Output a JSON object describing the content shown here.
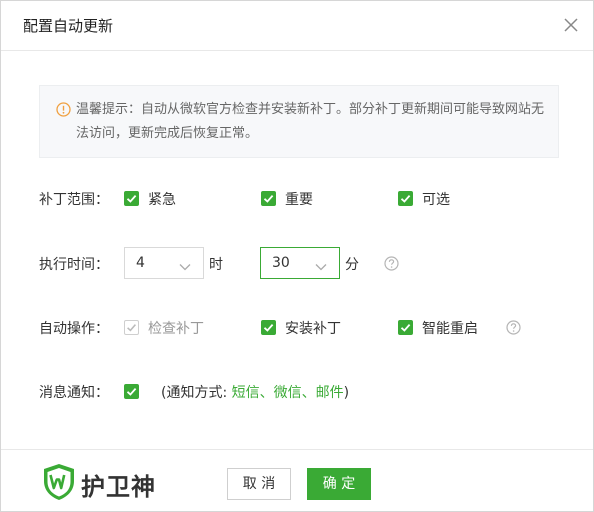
{
  "dialog": {
    "title": "配置自动更新",
    "close_icon": "close-icon"
  },
  "notice": {
    "icon": "warning-icon",
    "text": "温馨提示：自动从微软官方检查并安装新补丁。部分补丁更新期间可能导致网站无法访问，更新完成后恢复正常。"
  },
  "patch_scope": {
    "label": "补丁范围：",
    "options": [
      {
        "label": "紧急",
        "checked": true
      },
      {
        "label": "重要",
        "checked": true
      },
      {
        "label": "可选",
        "checked": true
      }
    ]
  },
  "exec_time": {
    "label": "执行时间：",
    "hour": "4",
    "hour_unit": "时",
    "minute": "30",
    "minute_unit": "分"
  },
  "auto_ops": {
    "label": "自动操作：",
    "options": [
      {
        "label": "检查补丁",
        "checked": true,
        "disabled": true
      },
      {
        "label": "安装补丁",
        "checked": true
      },
      {
        "label": "智能重启",
        "checked": true
      }
    ]
  },
  "notification": {
    "label": "消息通知：",
    "checked": true,
    "prefix": "(通知方式: ",
    "methods": "短信、微信、邮件",
    "suffix": ")"
  },
  "footer": {
    "brand": "护卫神",
    "cancel_label": "取 消",
    "ok_label": "确 定"
  },
  "colors": {
    "accent": "#3aaa35",
    "warning": "#f0a040"
  }
}
